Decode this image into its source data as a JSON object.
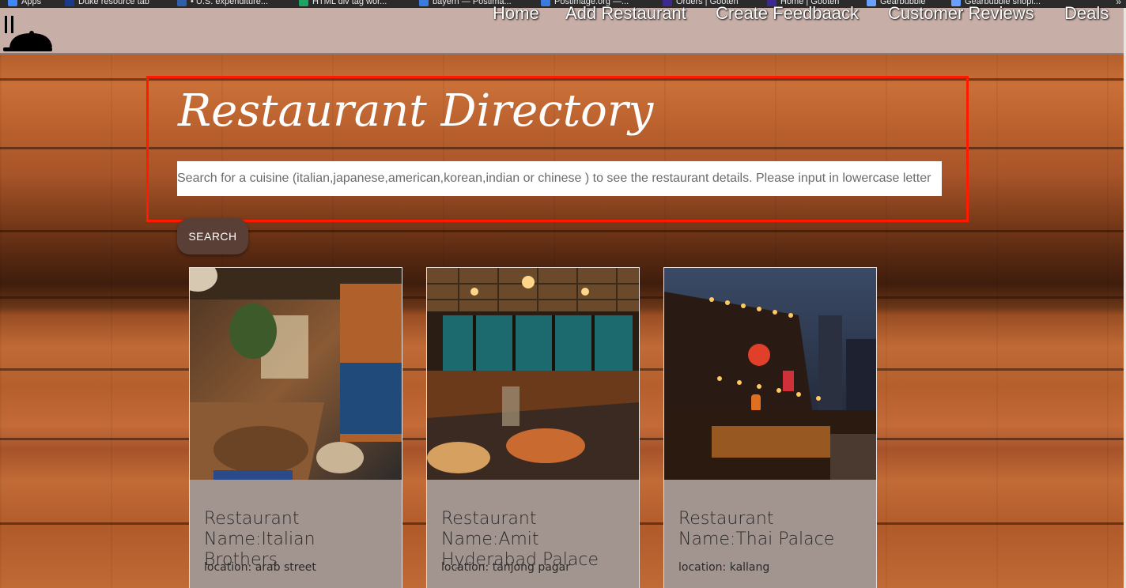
{
  "bookmarks": [
    {
      "label": "Apps",
      "color": "#4285f4"
    },
    {
      "label": "Duke resource tab",
      "color": "#1a3a8c"
    },
    {
      "label": "• U.S. expenditure...",
      "color": "#2f5fa8"
    },
    {
      "label": "HTML div tag wor...",
      "color": "#1fa463"
    },
    {
      "label": "bayern — Postima...",
      "color": "#3b7be0"
    },
    {
      "label": "Postimage.org —...",
      "color": "#3b7be0"
    },
    {
      "label": "Orders | Gooten",
      "color": "#3d2a8f"
    },
    {
      "label": "Home | Gooten",
      "color": "#3d2a8f"
    },
    {
      "label": "Gearbubble",
      "color": "#6aa0ff"
    },
    {
      "label": "Gearbubble shopi...",
      "color": "#6aa0ff"
    }
  ],
  "bookmarks_more": "»",
  "nav": {
    "links": [
      "Home",
      "Add Restaurant",
      "Create Feedbaack",
      "Customer Reviews",
      "Deals"
    ]
  },
  "header": {
    "title": "Restaurant Directory",
    "search_placeholder": "Search for a cuisine (italian,japanese,american,korean,indian or chinese ) to see the restaurant details. Please input in lowercase letter",
    "search_button": "SEARCH"
  },
  "restaurants": [
    {
      "name": "Restaurant Name:Italian Brothers",
      "location": "location: arab street"
    },
    {
      "name": "Restaurant Name:Amit Hyderabad Palace",
      "location": "location: tanjong pagar"
    },
    {
      "name": "Restaurant Name:Thai Palace",
      "location": "location: kallang"
    }
  ],
  "colors": {
    "highlight_border": "#ff1a00",
    "navbar": "#c7aea6",
    "search_button": "#5a3f36",
    "card_body": "#a29590"
  }
}
